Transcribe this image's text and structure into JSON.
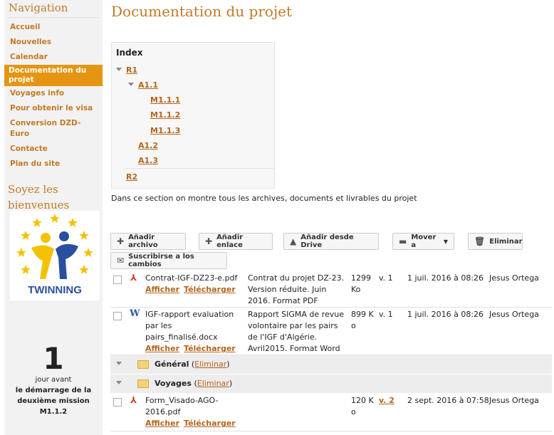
{
  "sidebar": {
    "nav_title": "Navigation",
    "items": [
      {
        "label": "Accueil"
      },
      {
        "label": "Nouvelles"
      },
      {
        "label": "Calendar"
      },
      {
        "label": "Documentation du projet",
        "active": true
      },
      {
        "label": "Voyages info"
      },
      {
        "label": "Pour obtenir le visa"
      },
      {
        "label": "Conversion DZD- Euro"
      },
      {
        "label": "Contacte"
      },
      {
        "label": "Plan du site"
      }
    ],
    "welcome_line1": "Soyez les",
    "welcome_line2": "bienvenues",
    "logo_text": "TWINNING",
    "countdown": {
      "number": "1",
      "line1": "jour avant",
      "line2": "le démarrage de la",
      "line3": "deuxième mission",
      "line4": "M1.1.2"
    }
  },
  "main": {
    "title": "Documentation du projet",
    "index": {
      "heading": "Index",
      "items": [
        "R1",
        "A1.1",
        "M1.1.1",
        "M1.1.2",
        "M1.1.3",
        "A1.2",
        "A1.3",
        "R2"
      ]
    },
    "description": "Dans ce section on montre tous les archives, documents et livrables du projet",
    "toolbar": {
      "add_file": "Añadir archivo",
      "add_link": "Añadir enlace",
      "add_drive": "Añadir desde Drive",
      "move": "Mover a",
      "delete": "Eliminar",
      "subscribe": "Suscribirse a los cambios"
    },
    "files": [
      {
        "name": "Contrat-IGF-DZ23-e.pdf",
        "desc1": "Contrat du projet DZ-23.",
        "desc2": "Version réduite. Juin",
        "desc3": "2016. Format PDF",
        "size1": "1299",
        "size2": "Ko",
        "version": "v. 1",
        "date": "1 juil. 2016 à 08:26",
        "author": "Jesus Ortega",
        "view": "Afficher",
        "download": "Télécharger"
      },
      {
        "name1": "IGF-rapport evaluation",
        "name2": "par les",
        "name3": "pairs_finalisé.docx",
        "desc1": "Rapport SIGMA de revue",
        "desc2": "volontaire par les pairs",
        "desc3": "de l'IGF d'Algérie.",
        "desc4": "Avril2015. Format Word",
        "size1": "899 K",
        "size2": "o",
        "version": "v. 1",
        "date": "1 juil. 2016 à 08:26",
        "author": "Jesus Ortega",
        "view": "Afficher",
        "download": "Télécharger"
      },
      {
        "name1": "Form_Visado-AGO-",
        "name2": "2016.pdf",
        "size1": "120 K",
        "size2": "o",
        "version": "v. 2",
        "date": "2 sept. 2016 à 07:58",
        "author": "Jesus Ortega",
        "view": "Afficher",
        "download": "Télécharger"
      }
    ],
    "folders": [
      {
        "name": "Général",
        "action": "Eliminar"
      },
      {
        "name": "Voyages",
        "action": "Eliminar"
      }
    ]
  },
  "colors": {
    "accent": "#c27a28",
    "active_bg": "#e69512"
  }
}
